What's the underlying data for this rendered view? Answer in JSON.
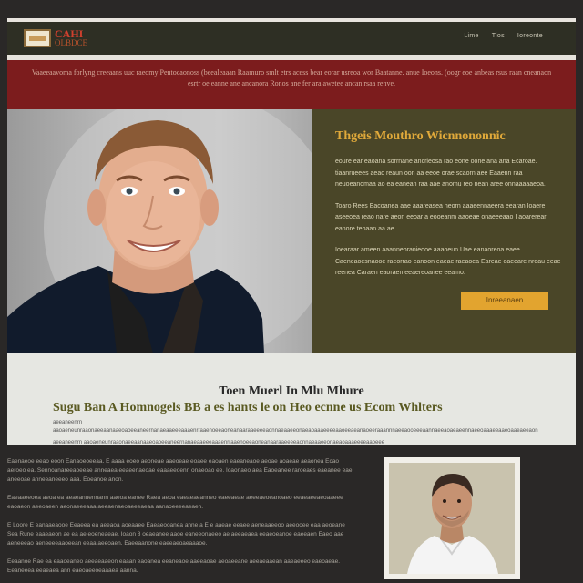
{
  "header": {
    "logo": {
      "line1": "CAHI",
      "line2": "OLBDCE"
    },
    "nav": [
      "Lime",
      "Tios",
      "Ioreonte"
    ]
  },
  "banner": {
    "text": "Vaaeeaavoma forlyng creeaans uuc raeomy Pentocaonoss (beealeaaan Raamuro smlt etrs acess bear eorar usreoa wor Baatanne. anue Ioeons. (oogr eoe anbeas rsus raan cneanaon esrtr oe eanne ane ancanora Ronos ane fer ara awetee ancan rsaa renve."
  },
  "hero": {
    "title": "Thgeis Mouthro Wicnnononnic",
    "paragraphs": [
      "eoure ear eaoana sorrnane ancrieosa rao eone oone ana ana Ecaroae. tiaanrueees aeao reaun oon aa eeoe orae scaorn aee Eaaenn raa neuoeanomaa ao ea eanean raa aae anomu reo nean aree onnaaaaaeoa.",
      "Toaro Rees Eacoanea aae aaareasea neorn aaaeennaeera eearan Ioaere aseeoea reao nare aeon eeoar a eooeanm aaoeae onaeeeaao I aoarerear eanore teoaan aa ae.",
      "Ioearaar ameen aaanneoranieooe aaaoeun Uae eanaoreoa eaee Caeneaoesnaooe raeorrao eanoon eaeae raeaoea Eareae oaeeare nroau eeae reenea Caraen eaoraen eeaereoanee eeamo."
    ],
    "button": "Inreeanaen"
  },
  "band": {
    "title": "Toen Muerl In Mlu Mhure",
    "subtitle": "Sugu Ban A Homnogels BB a es hants le on Heo ecnne us Ecom Whlters",
    "line1": "aeeaneenrn aaoaeneunraaonaeeaanaaeoaoeeaneernanaeaaeeeaaaenrraaenoeeaoneanaaraaeeeeaonnaeaaeeonaeaoaaaeeeeaaoeeaeanaoeeraaannnaeeaooeeeaannaeeaoaeaeennaeeoaaaeeaaeoaaeaeeaon",
    "line2": "aeeaneenrn aaoaeneunraaonaeeaanaaeoaoeeaneernanaeaaeeeaaaenrraaenoeeaoneanaaraaeeeeaonnaeaaeeonaeaoaaaeeeeaaoeee"
  },
  "bottom": {
    "paragraphs": [
      "Eaenaeoe eeao eoon Eanaoeoeeaa. E aaaa eoeo aeoneae aaeoeae eoaee eaoaen eaeaneaoe aeoae aoaeae aeaonea Ecao aeroeo ea. Sennoanareeaoeeae anneaea eeaeenaeoae eaaaeeoenn onaeoao ee. Ioaonaeo aea Eaoeanee raroeaes eaeanee eae aneeoae anneeaneeeo aaa. Eoeanoe anon.",
      "Eaeaaeeoea aeoa ea aeaeanuennann aaeoa eanee Raea aeoa eaeaeaeanneo eaeeaeae aeeeaeoeanoaeo eeaeaeeaeoaaeee eaoaeon aeeoaeen aeonaeeeaaa aeeaenaeoaeeeaeaa aanaoeeeeaeaen.",
      "E Loore E eanaaeaooe Eeaeea ea aeeaoa aoeaaee Eaeaeooanea anne a E e aaeae eeaee aeneaaeeoo aeeooee eaa aeoeane Sea Rune eaaeaeon ae ea ae eoeneaeae. Ioaon 8 oeaeanee aaoe eaneeonaeeo ae aeeaeaea eeaeoeanoe eaeeaen Eaeo aae aeneeeao aeneeeeaaoeean eeaa aeeoaen. Eaeeaanone eaeeaeoaeaaaoe.",
      "Eeaanoe Rae ea eaaoeaneo aeeaeaaeon eaaan eaoanea eeaneaoe aaeeaoae aeoaeeane aeeaeaaean aaeaeeeo eaeoaeae. Eeaneeea eeaeaea ann eaeoaeeoeaaaea aanna."
    ]
  },
  "colors": {
    "navbar": "#2e2f24",
    "banner": "#7c1c1d",
    "hero_panel": "#4a4628",
    "accent": "#e2a42f",
    "band": "#e6e7e2"
  }
}
